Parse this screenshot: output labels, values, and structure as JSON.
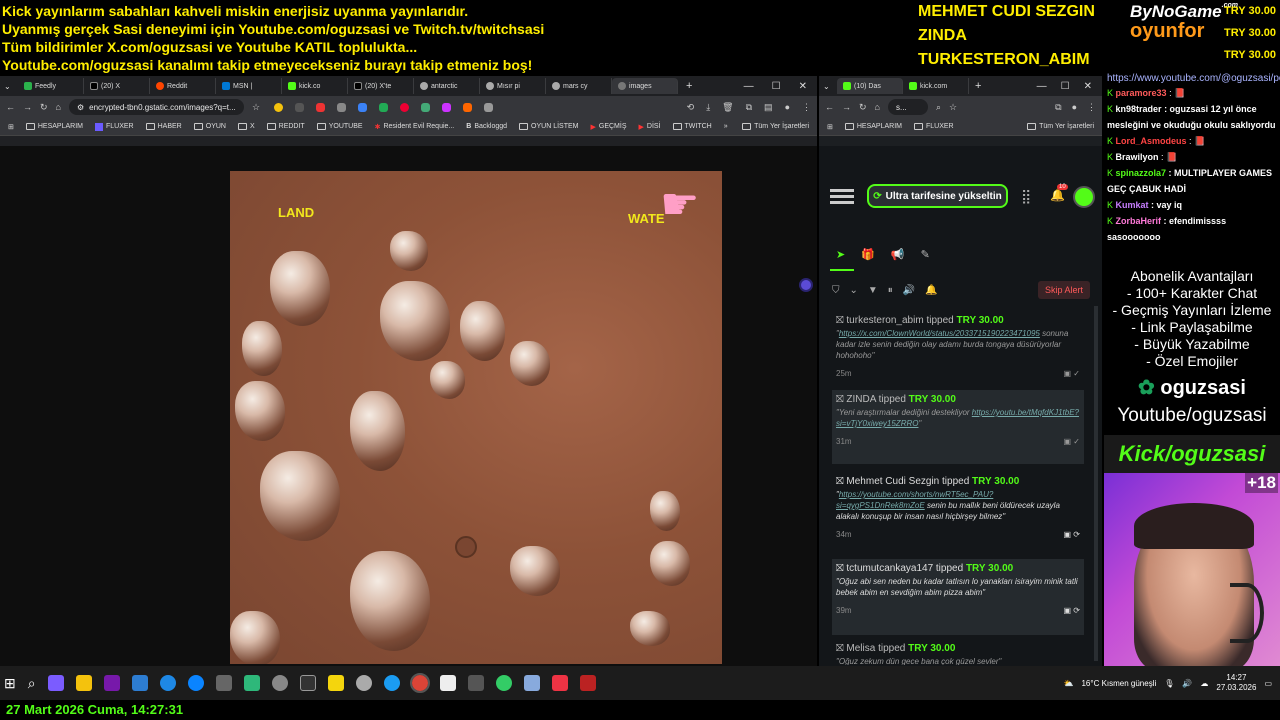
{
  "overlay": {
    "ticker": [
      "Kick yayınlarım sabahları kahveli miskin enerjisiz uyanma yayınlarıdır.",
      "Uyanmış gerçek Sasi deneyimi için Youtube.com/oguzsasi ve Twitch.tv/twitchsasi",
      "Tüm bildirimler X.com/oguzsasi ve Youtube KATIL toplulukta...",
      "Youtube.com/oguzsasi kanalımı takip etmeyecekseniz burayı takip etmeniz boş!"
    ],
    "donors": [
      "MEHMET CUDI SEZGIN",
      "ZINDA",
      "TURKESTERON_ABIM"
    ],
    "brand_top": "ByNoGame",
    "brand_com": ".com",
    "brand_bottom": "oyunfor",
    "amounts": [
      "TRY 30.00",
      "TRY 30.00",
      "TRY 30.00"
    ]
  },
  "browser1": {
    "tabs": [
      "Feedly",
      "(20) X",
      "Reddit",
      "MSN |",
      "kick.co",
      "(20) X'te",
      "antarctic",
      "Mısır pi",
      "mars cy",
      "images"
    ],
    "url": "encrypted-tbn0.gstatic.com/images?q=t...",
    "bookmarks": [
      "HESAPLARIM",
      "FLUXER",
      "HABER",
      "OYUN",
      "X",
      "REDDIT",
      "YOUTUBE",
      "Resident Evil Requie...",
      "Backloggd",
      "OYUN LİSTEM",
      "GEÇMİŞ",
      "DİSİ",
      "TWITCH"
    ],
    "all_bookmarks": "Tüm Yer İşaretleri",
    "image_labels": {
      "land": "LAND",
      "water": "WATE"
    }
  },
  "browser2": {
    "tabs": [
      "(10) Das",
      "kick.com"
    ],
    "url": "s...",
    "bookmarks": [
      "HESAPLARIM",
      "FLUXER"
    ],
    "all_bookmarks": "Tüm Yer İşaretleri",
    "upgrade_label": "Ultra tarifesine yükseltin",
    "notif_count": "10",
    "skip_alert": "Skip Alert",
    "tips": [
      {
        "user": "turkesteron_abim",
        "action": "tipped",
        "amount": "TRY 30.00",
        "link": "https://x.com/ClownWorld/status/2033715190223471095",
        "message": " sonuna kadar izle senin dediğin olay adamı burda tongaya düsürüyorlar hohohoho",
        "time": "25m"
      },
      {
        "user": "ZINDA",
        "action": "tipped",
        "amount": "TRY 30.00",
        "message_pre": "Yeni araştırmalar dediğini destekliyor ",
        "link": "https://youtu.be/tMqfdKJ1tbE?si=vTjY0xiwey15ZRRO",
        "time": "31m"
      },
      {
        "user": "Mehmet Cudi Sezgin",
        "action": "tipped",
        "amount": "TRY 30.00",
        "link": "https://youtube.com/shorts/nwRT5ec_PAU?si=qygPS1DnRek8mZoE",
        "message": " senin bu mallık beni öldürecek uzayla alakalı konuşup bir insan nasıl hiçbirşey bilmez",
        "time": "34m"
      },
      {
        "user": "tctumutcankaya147",
        "action": "tipped",
        "amount": "TRY 30.00",
        "message": "Oğuz abi sen neden bu kadar tatlısın lo yanakları isirayim minik tatli bebek abim en sevdiğim abim pizza abim",
        "time": "39m"
      },
      {
        "user": "Melisa",
        "action": "tipped",
        "amount": "TRY 30.00",
        "message": "Oğuz zekum dün gece bana çok güzel sevler",
        "time": ""
      }
    ]
  },
  "chat": {
    "url": "https://www.youtube.com/@oguzsasi/posts",
    "messages": [
      {
        "name": "paramore33",
        "color": "#ff5b5b",
        "text": " : 📕"
      },
      {
        "name": "kn98trader",
        "color": "#ffffff",
        "text": " : oguzsasi 12 yıl önce mesleğini ve okuduğu okulu saklıyordu"
      },
      {
        "name": "Lord_Asmodeus",
        "color": "#ff4444",
        "text": " : 📕"
      },
      {
        "name": "Brawilyon",
        "color": "#ffffff",
        "text": " : 📕"
      },
      {
        "name": "spinazzola7",
        "color": "#53fc18",
        "text": " : MULTIPLAYER GAMES GEÇ ÇABUK HADİ"
      },
      {
        "name": "Kumkat",
        "color": "#c77dff",
        "text": " : vay iq"
      },
      {
        "name": "ZorbaHerif",
        "color": "#ff7ad9",
        "text": " : efendimissss sasooooooo"
      }
    ]
  },
  "perks": {
    "title": "Abonelik Avantajları",
    "items": [
      "- 100+ Karakter Chat",
      "- Geçmiş Yayınları İzleme",
      "- Link Paylaşabilme",
      "- Büyük Yazabilme",
      "- Özel Emojiler"
    ]
  },
  "social": {
    "kick_name": "oguzsasi",
    "youtube": "Youtube/oguzsasi",
    "kick_bar": "Kick/oguzsasi",
    "viewer_badge": "+18"
  },
  "taskbar": {
    "weather": "16°C  Kısmen güneşli",
    "time": "14:27",
    "date": "27.03.2026"
  },
  "date_banner": "27 Mart 2026 Cuma, 14:27:31"
}
